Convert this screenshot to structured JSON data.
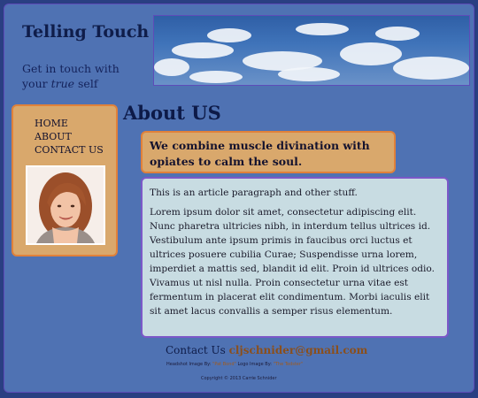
{
  "header": {
    "site_title": "Telling Touch",
    "tagline_pre": "Get in touch with your ",
    "tagline_em": "true",
    "tagline_post": " self"
  },
  "nav": {
    "items": [
      {
        "label": "HOME"
      },
      {
        "label": "ABOUT"
      },
      {
        "label": "CONTACT US"
      }
    ]
  },
  "main": {
    "page_title": "About US",
    "highlight": "We combine muscle divination with opiates to calm the soul.",
    "article": {
      "intro": "This is an article paragraph and other stuff.",
      "body": "Lorem ipsum dolor sit amet, consectetur adipiscing elit. Nunc pharetra ultricies nibh, in interdum tellus ultrices id. Vestibulum ante ipsum primis in faucibus orci luctus et ultrices posuere cubilia Curae; Suspendisse urna lorem, imperdiet a mattis sed, blandit id elit. Proin id ultrices odio. Vivamus ut nisl nulla. Proin consectetur urna vitae est fermentum in placerat elit condimentum. Morbi iaculis elit sit amet lacus convallis a semper risus elementum."
    }
  },
  "footer": {
    "contact_label": "Contact Us ",
    "email": "cljschnider@gmail.com",
    "credit_header_label": "Headshot Image By: ",
    "credit_header_name": "\"Pat Bond\"",
    "credit_logo_label": " Logo Image By: ",
    "credit_logo_name": "\"The Tedster\"",
    "copyright": "Copyright © 2013 Carrie Schnider"
  },
  "colors": {
    "page_bg": "#4f72b3",
    "accent_tan": "#d9a86c",
    "accent_orange_border": "#e0813a",
    "article_bg": "#c8dce2",
    "title_navy": "#0d1a48",
    "email_brown": "#8a4f1c"
  }
}
